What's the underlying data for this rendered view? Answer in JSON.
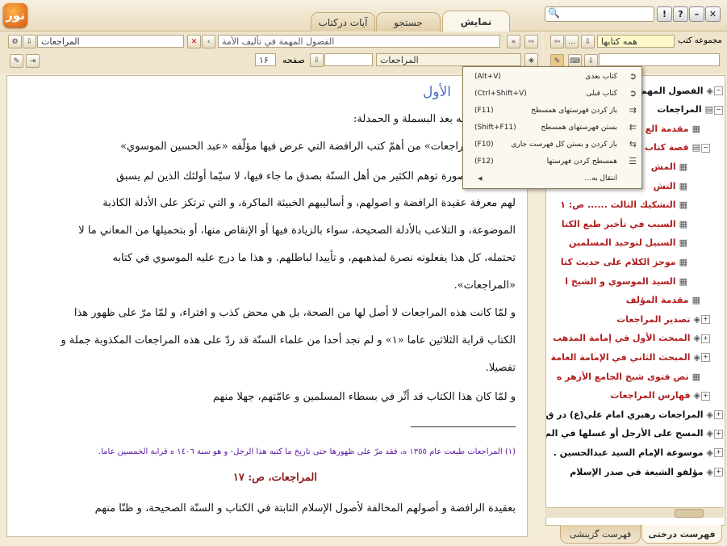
{
  "window": {
    "logo_text": "نور",
    "tabs": [
      "نمايش",
      "جستجو",
      "آيات درکتاب"
    ],
    "active_tab": 0,
    "buttons": [
      "✕",
      "–",
      "?",
      "!"
    ]
  },
  "left_toolbar": {
    "book_title": "المراجعات",
    "section_title": "الفصول المهمة في تأليف الأمة",
    "page_label": "صفحه",
    "page_value": "۱۶",
    "book_field": "المراجعات"
  },
  "right_toolbar": {
    "collection_label": "مجموعه كتب",
    "collection_value": "همه كتابها"
  },
  "document": {
    "heading": "الأول",
    "lines": [
      "مفتتحا ما كتبه بعد البسملة و الحمدلة:",
      "ر كتاب «المراجعات» من أهمّ كتب الرافضة التي عرض فيها مؤلّفه «عبد الحسين الموسوي»",
      "ب الرفض بصورة توهم الكثير من أهل السنّة بصدق ما جاء فيها، لا سيّما أولئك الذين لم يسبق",
      "لهم معرفة عقيدة الرافضة و اصولهم، و أساليبهم الخبيثة الماكرة، و التي ترتكز على الأدلة الكاذبة",
      "الموضوعة، و التلاعب بالأدلة الصحيحة، سواء بالزيادة فيها أو الإنقاص منها، أو بتحميلها من المعاني ما لا",
      "تحتمله، كل هذا يفعلونه نصرة لمذهبهم، و تأييدا لباطلهم. و هذا ما درج عليه الموسوي في كتابه",
      "«المراجعات».",
      "و لمّا كانت هذه المراجعات لا أصل لها من الصحة، بل هي محض كذب و افتراء، و لمّا مرّ على ظهور هذا",
      "الكتاب قرابة الثلاثين عاما «١» و لم نجد أحدا من علماء السنّة قد ردّ على هذه المراجعات المكذوبة جملة و",
      "تفصيلا.",
      "و لمّا كان هذا الكتاب قد أثّر في بسطاء المسلمين و عامّتهم، جهلا منهم"
    ],
    "footnote": "(١) المراجعات طبعت عام ١٣٥٥ ه، فقد مرّ على ظهورها حتى تاريخ ما كتبه هذا الرجل- و هو سنة ١٤٠٦ ه قرابة الخمسين عاما.",
    "page_marker": "المراجعات، ص: ١٧",
    "last_line": "بعقيدة الرافضة و أصولهم المخالفة لأصول الإسلام الثابتة في الكتاب و السنّة الصحيحة، و ظنّا منهم"
  },
  "context_menu": [
    {
      "label": "كتاب بعدى",
      "shortcut": "(Alt+V)",
      "icon": "book-next-icon"
    },
    {
      "label": "كتاب قبلى",
      "shortcut": "(Ctrl+Shift+V)",
      "icon": "book-prev-icon"
    },
    {
      "label": "باز كردن فهرستهاى همسطح",
      "shortcut": "(F11)",
      "icon": "expand-level-icon"
    },
    {
      "label": "بستن فهرستهاى همسطح",
      "shortcut": "(Shift+F11)",
      "icon": "collapse-level-icon"
    },
    {
      "label": "باز كردن و بستن كل فهرست جارى",
      "shortcut": "(F10)",
      "icon": "toggle-all-icon"
    },
    {
      "label": "همسطح كردن فهرستها",
      "shortcut": "(F12)",
      "icon": "flatten-icon"
    },
    {
      "label": "انتقال به...",
      "shortcut": "",
      "icon": "arrow-left-icon"
    }
  ],
  "tree": [
    {
      "label": "الفصول المهم",
      "level": 0,
      "color": "blk",
      "icon": "book-icon",
      "expander": "−"
    },
    {
      "label": "المراجعات",
      "level": 0,
      "color": "blk",
      "icon": "open-book-icon",
      "expander": "−"
    },
    {
      "label": "مقدمة الع",
      "level": 1,
      "color": "red",
      "icon": "page-icon"
    },
    {
      "label": "قصة كتاب",
      "level": 1,
      "color": "red",
      "icon": "open-book-icon",
      "expander": "−"
    },
    {
      "label": "المش",
      "level": 2,
      "color": "red",
      "icon": "page-icon"
    },
    {
      "label": "التش",
      "level": 2,
      "color": "red",
      "icon": "page-icon"
    },
    {
      "label": "التشكيك الثالث ...... ص: ١",
      "level": 2,
      "color": "red",
      "icon": "page-icon"
    },
    {
      "label": "السبب في تأخير طبع الكتا",
      "level": 2,
      "color": "red",
      "icon": "page-icon"
    },
    {
      "label": "السبيل لتوحيد المسلمين",
      "level": 2,
      "color": "red",
      "icon": "page-icon"
    },
    {
      "label": "موجز الكلام على حديث كتا",
      "level": 2,
      "color": "red",
      "icon": "page-icon"
    },
    {
      "label": "السيد الموسوي و الشيخ ا",
      "level": 2,
      "color": "red",
      "icon": "page-icon"
    },
    {
      "label": "مقدمة المؤلف",
      "level": 1,
      "color": "red",
      "icon": "page-icon"
    },
    {
      "label": "تصدير المراجعات",
      "level": 1,
      "color": "red",
      "icon": "book-icon",
      "expander": "+"
    },
    {
      "label": "المبحث الأول في إمامة المذهب",
      "level": 1,
      "color": "red",
      "icon": "book-icon",
      "expander": "+"
    },
    {
      "label": "المبحث الثاني في الإمامة العامة",
      "level": 1,
      "color": "red",
      "icon": "book-icon",
      "expander": "+"
    },
    {
      "label": "نص فتوى شيخ الجامع الأزهر ه",
      "level": 1,
      "color": "red",
      "icon": "page-icon"
    },
    {
      "label": "فهارس المراجعات",
      "level": 1,
      "color": "red",
      "icon": "book-icon",
      "expander": "+"
    },
    {
      "label": "المراجعات رهبري امام علي(ع) در ق",
      "level": 0,
      "color": "blk",
      "icon": "book-icon",
      "expander": "+"
    },
    {
      "label": "المسح على الأرجل أو غسلها في الم",
      "level": 0,
      "color": "blk",
      "icon": "book-icon",
      "expander": "+"
    },
    {
      "label": "موسوعة الإمام السيد عبدالحسين .",
      "level": 0,
      "color": "blk",
      "icon": "book-icon",
      "expander": "+"
    },
    {
      "label": "مؤلفو الشيعة في صدر الإسلام",
      "level": 0,
      "color": "blk",
      "icon": "book-icon",
      "expander": "+"
    }
  ],
  "bottom_tabs": [
    "فهرست درختى",
    "فهرست گزينشى"
  ],
  "colors": {
    "accent": "#d4560c",
    "tree_red": "#8a1c1c",
    "footnote": "#5a1aa0",
    "marker": "#8a1c1c"
  }
}
